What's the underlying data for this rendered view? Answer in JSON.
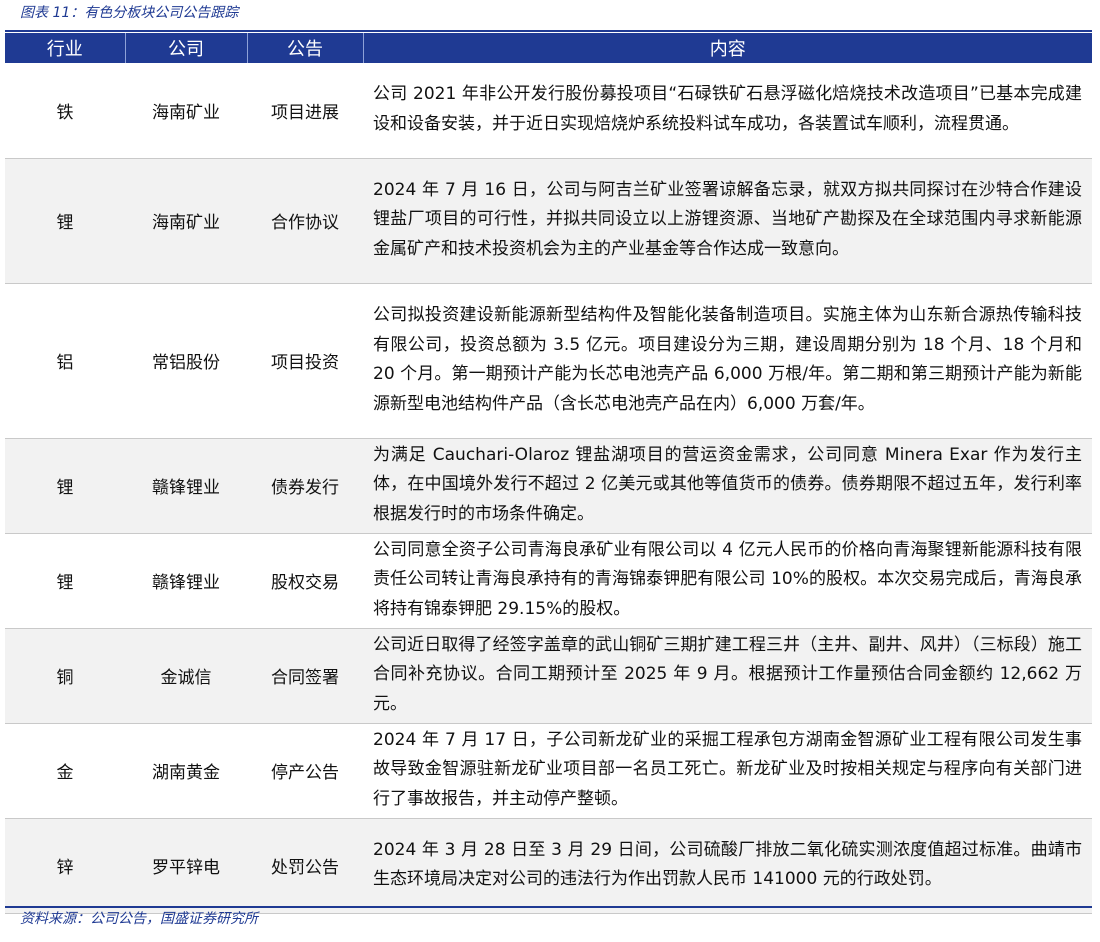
{
  "caption": "图表 11：有色分板块公司公告跟踪",
  "headers": [
    "行业",
    "公司",
    "公告",
    "内容"
  ],
  "rows": [
    {
      "industry": "铁",
      "company": "海南矿业",
      "type": "项目进展",
      "content": "公司 2021 年非公开发行股份募投项目“石碌铁矿石悬浮磁化焙烧技术改造项目”已基本完成建设和设备安装，并于近日实现焙烧炉系统投料试车成功，各装置试车顺利，流程贯通。"
    },
    {
      "industry": "锂",
      "company": "海南矿业",
      "type": "合作协议",
      "content": "2024 年 7 月 16 日，公司与阿吉兰矿业签署谅解备忘录，就双方拟共同探讨在沙特合作建设锂盐厂项目的可行性，并拟共同设立以上游锂资源、当地矿产勘探及在全球范围内寻求新能源金属矿产和技术投资机会为主的产业基金等合作达成一致意向。"
    },
    {
      "industry": "铝",
      "company": "常铝股份",
      "type": "项目投资",
      "content": "公司拟投资建设新能源新型结构件及智能化装备制造项目。实施主体为山东新合源热传输科技有限公司，投资总额为 3.5 亿元。项目建设分为三期，建设周期分别为 18 个月、18 个月和 20 个月。第一期预计产能为长芯电池壳产品 6,000 万根/年。第二期和第三期预计产能为新能源新型电池结构件产品（含长芯电池壳产品在内）6,000 万套/年。"
    },
    {
      "industry": "锂",
      "company": "赣锋锂业",
      "type": "债券发行",
      "content": "为满足 Cauchari-Olaroz 锂盐湖项目的营运资金需求，公司同意 Minera Exar 作为发行主体，在中国境外发行不超过 2 亿美元或其他等值货币的债券。债券期限不超过五年，发行利率根据发行时的市场条件确定。"
    },
    {
      "industry": "锂",
      "company": "赣锋锂业",
      "type": "股权交易",
      "content": "公司同意全资子公司青海良承矿业有限公司以 4 亿元人民币的价格向青海聚锂新能源科技有限责任公司转让青海良承持有的青海锦泰钾肥有限公司 10%的股权。本次交易完成后，青海良承将持有锦泰钾肥 29.15%的股权。"
    },
    {
      "industry": "铜",
      "company": "金诚信",
      "type": "合同签署",
      "content": "公司近日取得了经签字盖章的武山铜矿三期扩建工程三井（主井、副井、风井）（三标段）施工合同补充协议。合同工期预计至 2025 年 9 月。根据预计工作量预估合同金额约 12,662 万元。"
    },
    {
      "industry": "金",
      "company": "湖南黄金",
      "type": "停产公告",
      "content": "2024 年 7 月 17 日，子公司新龙矿业的采掘工程承包方湖南金智源矿业工程有限公司发生事故导致金智源驻新龙矿业项目部一名员工死亡。新龙矿业及时按相关规定与程序向有关部门进行了事故报告，并主动停产整顿。"
    },
    {
      "industry": "锌",
      "company": "罗平锌电",
      "type": "处罚公告",
      "content": "2024 年 3 月 28 日至 3 月 29 日间，公司硫酸厂排放二氧化硫实测浓度值超过标准。曲靖市生态环境局决定对公司的违法行为作出罚款人民币 141000 元的行政处罚。"
    }
  ],
  "source": "资料来源：公司公告，国盛证券研究所"
}
